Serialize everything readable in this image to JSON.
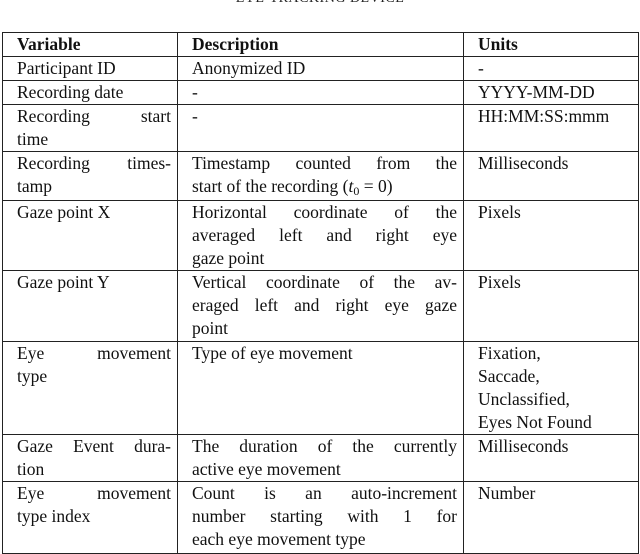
{
  "caption": "EYE-TRACKING DEVICE",
  "table": {
    "headers": {
      "variable": "Variable",
      "description": "Description",
      "units": "Units"
    },
    "rows": [
      {
        "variable": [
          "Participant ID"
        ],
        "description": [
          "Anonymized ID"
        ],
        "units": [
          "-"
        ]
      },
      {
        "variable": [
          "Recording date"
        ],
        "description": [
          "-"
        ],
        "units": [
          "YYYY-MM-DD"
        ]
      },
      {
        "variable": [
          "Recording start",
          "time"
        ],
        "description": [
          "-"
        ],
        "units": [
          "HH:MM:SS:mmm"
        ]
      },
      {
        "variable": [
          "Recording times-",
          "tamp"
        ],
        "description": [
          "Timestamp counted from the",
          "start of the recording ("
        ],
        "description_math": {
          "var": "t",
          "sub": "0",
          "rest": " = 0)"
        },
        "units": [
          "Milliseconds"
        ]
      },
      {
        "variable": [
          "Gaze point X"
        ],
        "description": [
          "Horizontal coordinate of the",
          "averaged left and right eye",
          "gaze point"
        ],
        "units": [
          "Pixels"
        ]
      },
      {
        "variable": [
          "Gaze point Y"
        ],
        "description": [
          "Vertical coordinate of the av-",
          "eraged left and right eye gaze",
          "point"
        ],
        "units": [
          "Pixels"
        ]
      },
      {
        "variable": [
          "Eye movement",
          "type"
        ],
        "description": [
          "Type of eye movement"
        ],
        "units": [
          "Fixation,",
          "Saccade,",
          "Unclassified,",
          "Eyes Not Found"
        ]
      },
      {
        "variable": [
          "Gaze Event dura-",
          "tion"
        ],
        "description": [
          "The duration of the currently",
          "active eye movement"
        ],
        "units": [
          "Milliseconds"
        ]
      },
      {
        "variable": [
          "Eye movement",
          "type index"
        ],
        "description": [
          "Count is an auto-increment",
          "number starting with 1 for",
          "each eye movement type"
        ],
        "units": [
          "Number"
        ]
      }
    ]
  }
}
